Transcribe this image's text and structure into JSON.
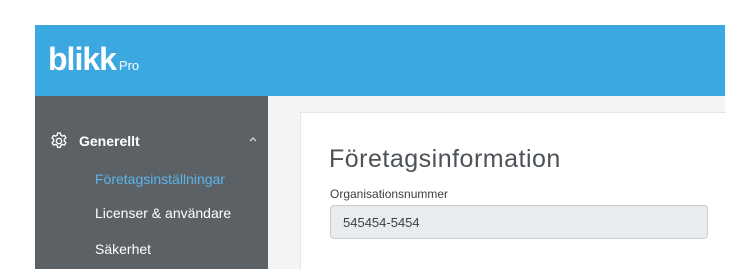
{
  "header": {
    "logo_text": "blikk",
    "logo_suffix": "Pro",
    "brand_color": "#3ca8e0"
  },
  "sidebar": {
    "group": {
      "label": "Generellt",
      "icon": "gear-icon",
      "expanded": true,
      "chevron_icon": "chevron-up-icon"
    },
    "items": [
      {
        "label": "Företagsinställningar",
        "active": true
      },
      {
        "label": "Licenser & användare",
        "active": false
      },
      {
        "label": "Säkerhet",
        "active": false
      }
    ]
  },
  "main": {
    "title": "Företagsinformation",
    "fields": [
      {
        "label": "Organisationsnummer",
        "value": "545454-5454"
      }
    ]
  },
  "colors": {
    "active_nav": "#5bb4ea",
    "sidebar_bg": "#5c6166",
    "input_bg": "#e9ecef"
  }
}
